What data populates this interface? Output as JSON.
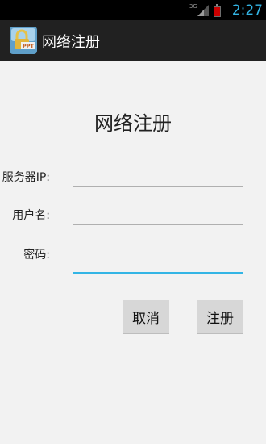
{
  "status_bar": {
    "network_label": "3G",
    "time": "2:27",
    "icons": [
      "signal-icon",
      "battery-icon"
    ],
    "clock_color": "#33b5e5"
  },
  "action_bar": {
    "title": "网络注册",
    "icon": "app-lock-icon"
  },
  "form": {
    "title": "网络注册",
    "fields": [
      {
        "label": "服务器IP:",
        "value": ""
      },
      {
        "label": "用户名:",
        "value": ""
      },
      {
        "label": "密码:",
        "value": "",
        "focused": true
      }
    ],
    "accent_color": "#33b5e5"
  },
  "buttons": {
    "cancel": "取消",
    "register": "注册"
  },
  "app_icon_text": "PPT"
}
